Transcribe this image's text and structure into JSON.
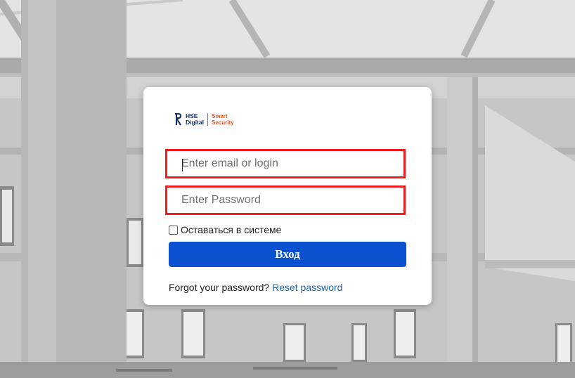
{
  "brand": {
    "hse_line1": "HSE",
    "hse_line2": "Digital",
    "product_line1": "Smart",
    "product_line2": "Security",
    "accent_color": "#e2572b",
    "navy_color": "#102d69"
  },
  "login_form": {
    "email_placeholder": "Enter email or login",
    "password_placeholder": "Enter Password",
    "remember_label": "Оставаться в системе",
    "remember_checked": false,
    "submit_label": "Вход",
    "forgot_text": "Forgot your password?",
    "reset_link": "Reset password",
    "button_color": "#0a50cf",
    "highlight_color": "#ee1c1c"
  }
}
